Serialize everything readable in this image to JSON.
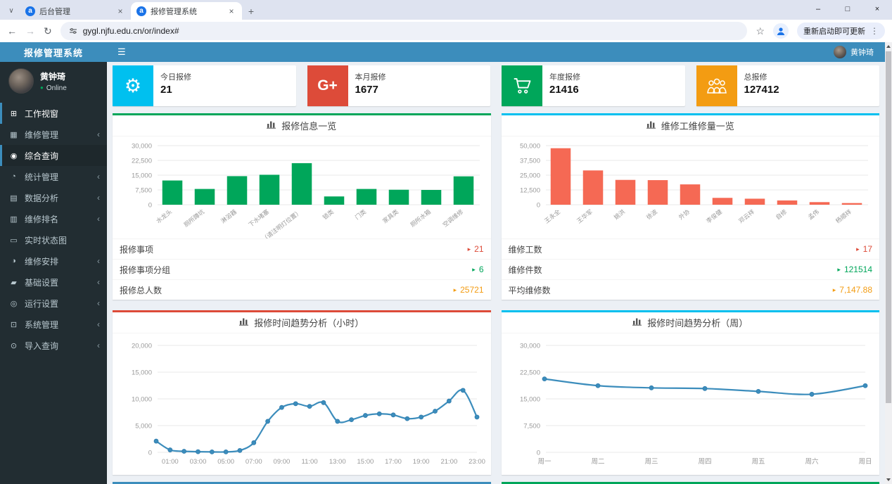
{
  "browser": {
    "tabs": [
      {
        "title": "后台管理"
      },
      {
        "title": "报修管理系统"
      }
    ],
    "favicon_letter": "a",
    "url": "gygl.njfu.edu.cn/or/index#",
    "update_button": "重新启动即可更新"
  },
  "icons": {
    "tab_search": "∨",
    "tab_close": "×",
    "new_tab": "+",
    "minimize": "–",
    "maximize": "□",
    "close": "×",
    "back": "←",
    "forward": "→",
    "reload": "↻",
    "star": "☆",
    "kebab": "⋮",
    "menu": "☰",
    "status_dot": "●",
    "caret_right": "▸",
    "submenu_arrow": "‹"
  },
  "sidebar": {
    "app_title": "报修管理系统",
    "user": {
      "name": "黄钟琦",
      "status": "Online"
    },
    "items": [
      {
        "label": "工作视窗",
        "icon": "desktop-icon",
        "glyph": "⊞",
        "arrow": false,
        "state": "current"
      },
      {
        "label": "维修管理",
        "icon": "calendar-icon",
        "glyph": "▦",
        "arrow": true,
        "state": ""
      },
      {
        "label": "综合查询",
        "icon": "comment-icon",
        "glyph": "◉",
        "arrow": false,
        "state": "active"
      },
      {
        "label": "统计管理",
        "icon": "pie-icon",
        "glyph": "◔",
        "arrow": true,
        "state": ""
      },
      {
        "label": "数据分析",
        "icon": "chart-icon",
        "glyph": "▤",
        "arrow": true,
        "state": ""
      },
      {
        "label": "维修排名",
        "icon": "rank-icon",
        "glyph": "▥",
        "arrow": true,
        "state": ""
      },
      {
        "label": "实时状态图",
        "icon": "monitor-icon",
        "glyph": "▭",
        "arrow": false,
        "state": ""
      },
      {
        "label": "维修安排",
        "icon": "schedule-icon",
        "glyph": "◑",
        "arrow": true,
        "state": ""
      },
      {
        "label": "基础设置",
        "icon": "settings-icon",
        "glyph": "▰",
        "arrow": true,
        "state": ""
      },
      {
        "label": "运行设置",
        "icon": "run-icon",
        "glyph": "◎",
        "arrow": true,
        "state": ""
      },
      {
        "label": "系统管理",
        "icon": "system-icon",
        "glyph": "⊡",
        "arrow": true,
        "state": ""
      },
      {
        "label": "导入查询",
        "icon": "search-icon",
        "glyph": "⊙",
        "arrow": true,
        "state": ""
      }
    ]
  },
  "header": {
    "user_name": "黄钟琦"
  },
  "cards": [
    {
      "label": "今日报修",
      "value": "21",
      "icon": "gear-icon",
      "color": "#00c0ef"
    },
    {
      "label": "本月报修",
      "value": "1677",
      "icon": "google-plus-icon",
      "color": "#dd4b39"
    },
    {
      "label": "年度报修",
      "value": "21416",
      "icon": "cart-icon",
      "color": "#00a65a"
    },
    {
      "label": "总报修",
      "value": "127412",
      "icon": "users-icon",
      "color": "#f39c12"
    }
  ],
  "panels": [
    {
      "title": "报修信息一览",
      "accent": "#00a65a",
      "chart": 0,
      "stats": [
        {
          "label": "报修事项",
          "value": "21",
          "color": "#dd4b39"
        },
        {
          "label": "报修事项分组",
          "value": "6",
          "color": "#00a65a"
        },
        {
          "label": "报修总人数",
          "value": "25721",
          "color": "#f39c12"
        }
      ]
    },
    {
      "title": "维修工维修量一览",
      "accent": "#00c0ef",
      "chart": 1,
      "stats": [
        {
          "label": "维修工数",
          "value": "17",
          "color": "#dd4b39"
        },
        {
          "label": "维修件数",
          "value": "121514",
          "color": "#00a65a"
        },
        {
          "label": "平均维修数",
          "value": "7,147.88",
          "color": "#f39c12"
        }
      ]
    },
    {
      "title": "报修时间趋势分析（小时）",
      "accent": "#dd4b39",
      "chart": 2,
      "stats": []
    },
    {
      "title": "报修时间趋势分析（周）",
      "accent": "#00c0ef",
      "chart": 3,
      "stats": []
    }
  ],
  "bottom_panels": [
    {
      "accent": "#3c8dbc"
    },
    {
      "accent": "#00a65a"
    }
  ],
  "chart_data": [
    {
      "type": "bar",
      "title": "报修信息一览",
      "categories": [
        "水龙头",
        "厕所蹲坑",
        "淋浴器",
        "下水堵塞",
        "灯（请注明灯位置）",
        "锁类",
        "门类",
        "家具类",
        "厕所水箱",
        "空调维修"
      ],
      "values": [
        12300,
        8000,
        14500,
        15200,
        21100,
        4200,
        8000,
        7600,
        7500,
        14400
      ],
      "xlabel": "",
      "ylabel": "",
      "ylim": [
        0,
        30000
      ],
      "yticks": [
        0,
        7500,
        15000,
        22500,
        30000
      ],
      "grid": true,
      "legend": "none",
      "color": "#00a65a"
    },
    {
      "type": "bar",
      "title": "维修工维修量一览",
      "categories": [
        "王永全",
        "王华军",
        "姚洪",
        "徐波",
        "外协",
        "李俊健",
        "邓云祥",
        "自修",
        "孟伟",
        "杨顺祥"
      ],
      "values": [
        47800,
        29000,
        21000,
        20800,
        17200,
        5800,
        5100,
        3600,
        2200,
        1400
      ],
      "xlabel": "",
      "ylabel": "",
      "ylim": [
        0,
        50000
      ],
      "yticks": [
        0,
        12500,
        25000,
        37500,
        50000
      ],
      "grid": true,
      "legend": "none",
      "color": "#f56954"
    },
    {
      "type": "line",
      "title": "报修时间趋势分析（小时）",
      "categories": [
        "00:00",
        "01:00",
        "02:00",
        "03:00",
        "04:00",
        "05:00",
        "06:00",
        "07:00",
        "08:00",
        "09:00",
        "10:00",
        "11:00",
        "12:00",
        "13:00",
        "14:00",
        "15:00",
        "16:00",
        "17:00",
        "18:00",
        "19:00",
        "20:00",
        "21:00",
        "22:00",
        "23:00"
      ],
      "values": [
        2100,
        450,
        200,
        120,
        80,
        80,
        350,
        1800,
        5800,
        8400,
        9100,
        8600,
        9300,
        5800,
        6100,
        6900,
        7200,
        7000,
        6300,
        6600,
        7700,
        9600,
        11600,
        6600
      ],
      "x_labels_shown": [
        "01:00",
        "03:00",
        "05:00",
        "07:00",
        "09:00",
        "11:00",
        "13:00",
        "15:00",
        "17:00",
        "19:00",
        "21:00",
        "23:00"
      ],
      "xlabel": "",
      "ylabel": "",
      "ylim": [
        0,
        20000
      ],
      "yticks": [
        0,
        5000,
        10000,
        15000,
        20000
      ],
      "grid": true,
      "legend": "none",
      "color": "#3c8dbc"
    },
    {
      "type": "line",
      "title": "报修时间趋势分析（周）",
      "categories": [
        "周一",
        "周二",
        "周三",
        "周四",
        "周五",
        "周六",
        "周日"
      ],
      "values": [
        20600,
        18700,
        18100,
        17900,
        17100,
        16300,
        18700
      ],
      "x_labels_shown": [
        "周一",
        "周二",
        "周三",
        "周四",
        "周五",
        "周六",
        "周日"
      ],
      "xlabel": "",
      "ylabel": "",
      "ylim": [
        0,
        30000
      ],
      "yticks": [
        0,
        7500,
        15000,
        22500,
        30000
      ],
      "grid": true,
      "legend": "none",
      "color": "#3c8dbc"
    }
  ]
}
